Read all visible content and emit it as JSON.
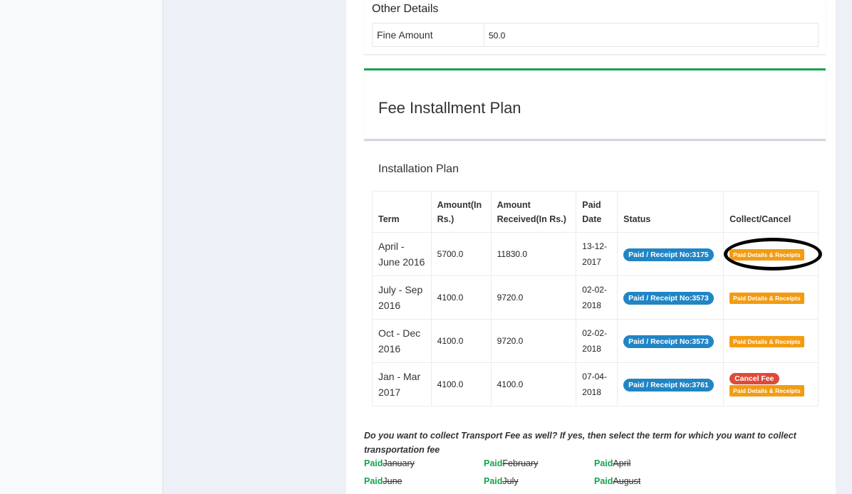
{
  "other_details": {
    "title": "Other Details",
    "fine_label": "Fine Amount",
    "fine_value": "50.0"
  },
  "fee_plan": {
    "title": "Fee Installment Plan"
  },
  "installation": {
    "title": "Installation Plan",
    "headers": [
      "Term",
      "Amount(In Rs.)",
      "Amount Received(In Rs.)",
      "Paid Date",
      "Status",
      "Collect/Cancel"
    ],
    "rows": [
      {
        "term": "April - June 2016",
        "amount": "5700.0",
        "received": "11830.0",
        "date": "13-12-2017",
        "status": "Paid / Receipt No:3175",
        "receipt_label": "Paid Details & Receipts"
      },
      {
        "term": "July - Sep 2016",
        "amount": "4100.0",
        "received": "9720.0",
        "date": "02-02-2018",
        "status": "Paid / Receipt No:3573",
        "receipt_label": "Paid Details & Receipts"
      },
      {
        "term": "Oct - Dec 2016",
        "amount": "4100.0",
        "received": "9720.0",
        "date": "02-02-2018",
        "status": "Paid / Receipt No:3573",
        "receipt_label": "Paid Details & Receipts"
      },
      {
        "term": "Jan - Mar 2017",
        "amount": "4100.0",
        "received": "4100.0",
        "date": "07-04-2018",
        "status": "Paid / Receipt No:3761",
        "cancel_label": "Cancel Fee",
        "receipt_label": "Paid Details & Receipts"
      }
    ]
  },
  "transport": {
    "question": "Do you want to collect Transport Fee as well? If yes, then select the term for which you want to collect transportation fee",
    "paid_label": "Paid",
    "months": [
      "January",
      "February",
      "April",
      "June",
      "July",
      "August"
    ]
  },
  "colors": {
    "green": "#14a44d",
    "blue_badge": "#2185c5",
    "orange_badge": "#f39c12",
    "red_badge": "#dd4b39"
  }
}
